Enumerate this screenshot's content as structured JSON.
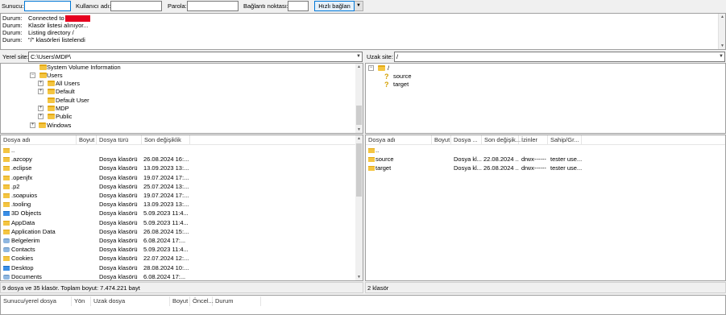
{
  "quickconnect": {
    "host_label": "Sunucu:",
    "user_label": "Kullanıcı adı:",
    "password_label": "Parola:",
    "port_label": "Bağlantı noktası:",
    "host_value": "",
    "user_value": "",
    "password_value": "",
    "port_value": "",
    "connect_button": "Hızlı bağlan",
    "dropdown_icon": "chevron-down-icon"
  },
  "log": {
    "lines": [
      {
        "key": "Durum:",
        "msg": "Connected to"
      },
      {
        "key": "Durum:",
        "msg": "Klasör listesi alınıyor..."
      },
      {
        "key": "Durum:",
        "msg": "Listing directory /"
      },
      {
        "key": "Durum:",
        "msg": "\"/\" klasörleri listelendi"
      }
    ]
  },
  "local": {
    "site_label": "Yerel site:",
    "site_path": "C:\\Users\\MDP\\",
    "tree": [
      {
        "label": "System Volume Information",
        "expander": ""
      },
      {
        "label": "Users",
        "expander": "−"
      },
      {
        "label": "All Users",
        "expander": "+"
      },
      {
        "label": "Default",
        "expander": "+"
      },
      {
        "label": "Default User",
        "expander": ""
      },
      {
        "label": "MDP",
        "expander": "+"
      },
      {
        "label": "Public",
        "expander": "+"
      },
      {
        "label": "Windows",
        "expander": "+"
      }
    ],
    "columns": {
      "name": "Dosya adı",
      "size": "Boyut",
      "type": "Dosya türü",
      "modified": "Son değişiklik"
    },
    "files": [
      {
        "name": "..",
        "type": "",
        "modified": "",
        "icon": "folder"
      },
      {
        "name": ".azcopy",
        "type": "Dosya klasörü",
        "modified": "26.08.2024 16:...",
        "icon": "folder"
      },
      {
        "name": ".eclipse",
        "type": "Dosya klasörü",
        "modified": "13.09.2023 13:...",
        "icon": "folder"
      },
      {
        "name": ".openjfx",
        "type": "Dosya klasörü",
        "modified": "19.07.2024 17:...",
        "icon": "folder"
      },
      {
        "name": ".p2",
        "type": "Dosya klasörü",
        "modified": "25.07.2024 13:...",
        "icon": "folder"
      },
      {
        "name": ".soapuios",
        "type": "Dosya klasörü",
        "modified": "19.07.2024 17:...",
        "icon": "folder"
      },
      {
        "name": ".tooling",
        "type": "Dosya klasörü",
        "modified": "13.09.2023 13:...",
        "icon": "folder"
      },
      {
        "name": "3D Objects",
        "type": "Dosya klasörü",
        "modified": "5.09.2023 11:4...",
        "icon": "special"
      },
      {
        "name": "AppData",
        "type": "Dosya klasörü",
        "modified": "5.09.2023 11:4...",
        "icon": "folder"
      },
      {
        "name": "Application Data",
        "type": "Dosya klasörü",
        "modified": "26.08.2024 15:...",
        "icon": "folder"
      },
      {
        "name": "Belgelerim",
        "type": "Dosya klasörü",
        "modified": "6.08.2024 17:...",
        "icon": "user"
      },
      {
        "name": "Contacts",
        "type": "Dosya klasörü",
        "modified": "5.09.2023 11:4...",
        "icon": "user"
      },
      {
        "name": "Cookies",
        "type": "Dosya klasörü",
        "modified": "22.07.2024 12:...",
        "icon": "folder"
      },
      {
        "name": "Desktop",
        "type": "Dosya klasörü",
        "modified": "28.08.2024 10:...",
        "icon": "special"
      },
      {
        "name": "Documents",
        "type": "Dosya klasörü",
        "modified": "6.08.2024 17:...",
        "icon": "user"
      }
    ],
    "status": "9 dosya ve 35 klasör. Toplam boyut: 7.474.221 bayt"
  },
  "remote": {
    "site_label": "Uzak site:",
    "site_path": "/",
    "tree": [
      {
        "label": "/",
        "expander": "−",
        "icon": "folder"
      },
      {
        "label": "source",
        "expander": "",
        "icon": "question"
      },
      {
        "label": "target",
        "expander": "",
        "icon": "question"
      }
    ],
    "columns": {
      "name": "Dosya adı",
      "size": "Boyut",
      "type": "Dosya ...",
      "modified": "Son değişik...",
      "perms": "İzinler",
      "owner": "Sahip/Gr..."
    },
    "files": [
      {
        "name": "..",
        "type": "",
        "modified": "",
        "perms": "",
        "owner": ""
      },
      {
        "name": "source",
        "type": "Dosya kl...",
        "modified": "22.08.2024 ...",
        "perms": "drwx------",
        "owner": "tester use..."
      },
      {
        "name": "target",
        "type": "Dosya kl...",
        "modified": "26.08.2024 ...",
        "perms": "drwx------",
        "owner": "tester use..."
      }
    ],
    "status": "2 klasör"
  },
  "queue": {
    "columns": {
      "server": "Sunucu/yerel dosya",
      "direction": "Yön",
      "remote": "Uzak dosya",
      "size": "Boyut",
      "priority": "Öncel...",
      "status": "Durum"
    }
  }
}
